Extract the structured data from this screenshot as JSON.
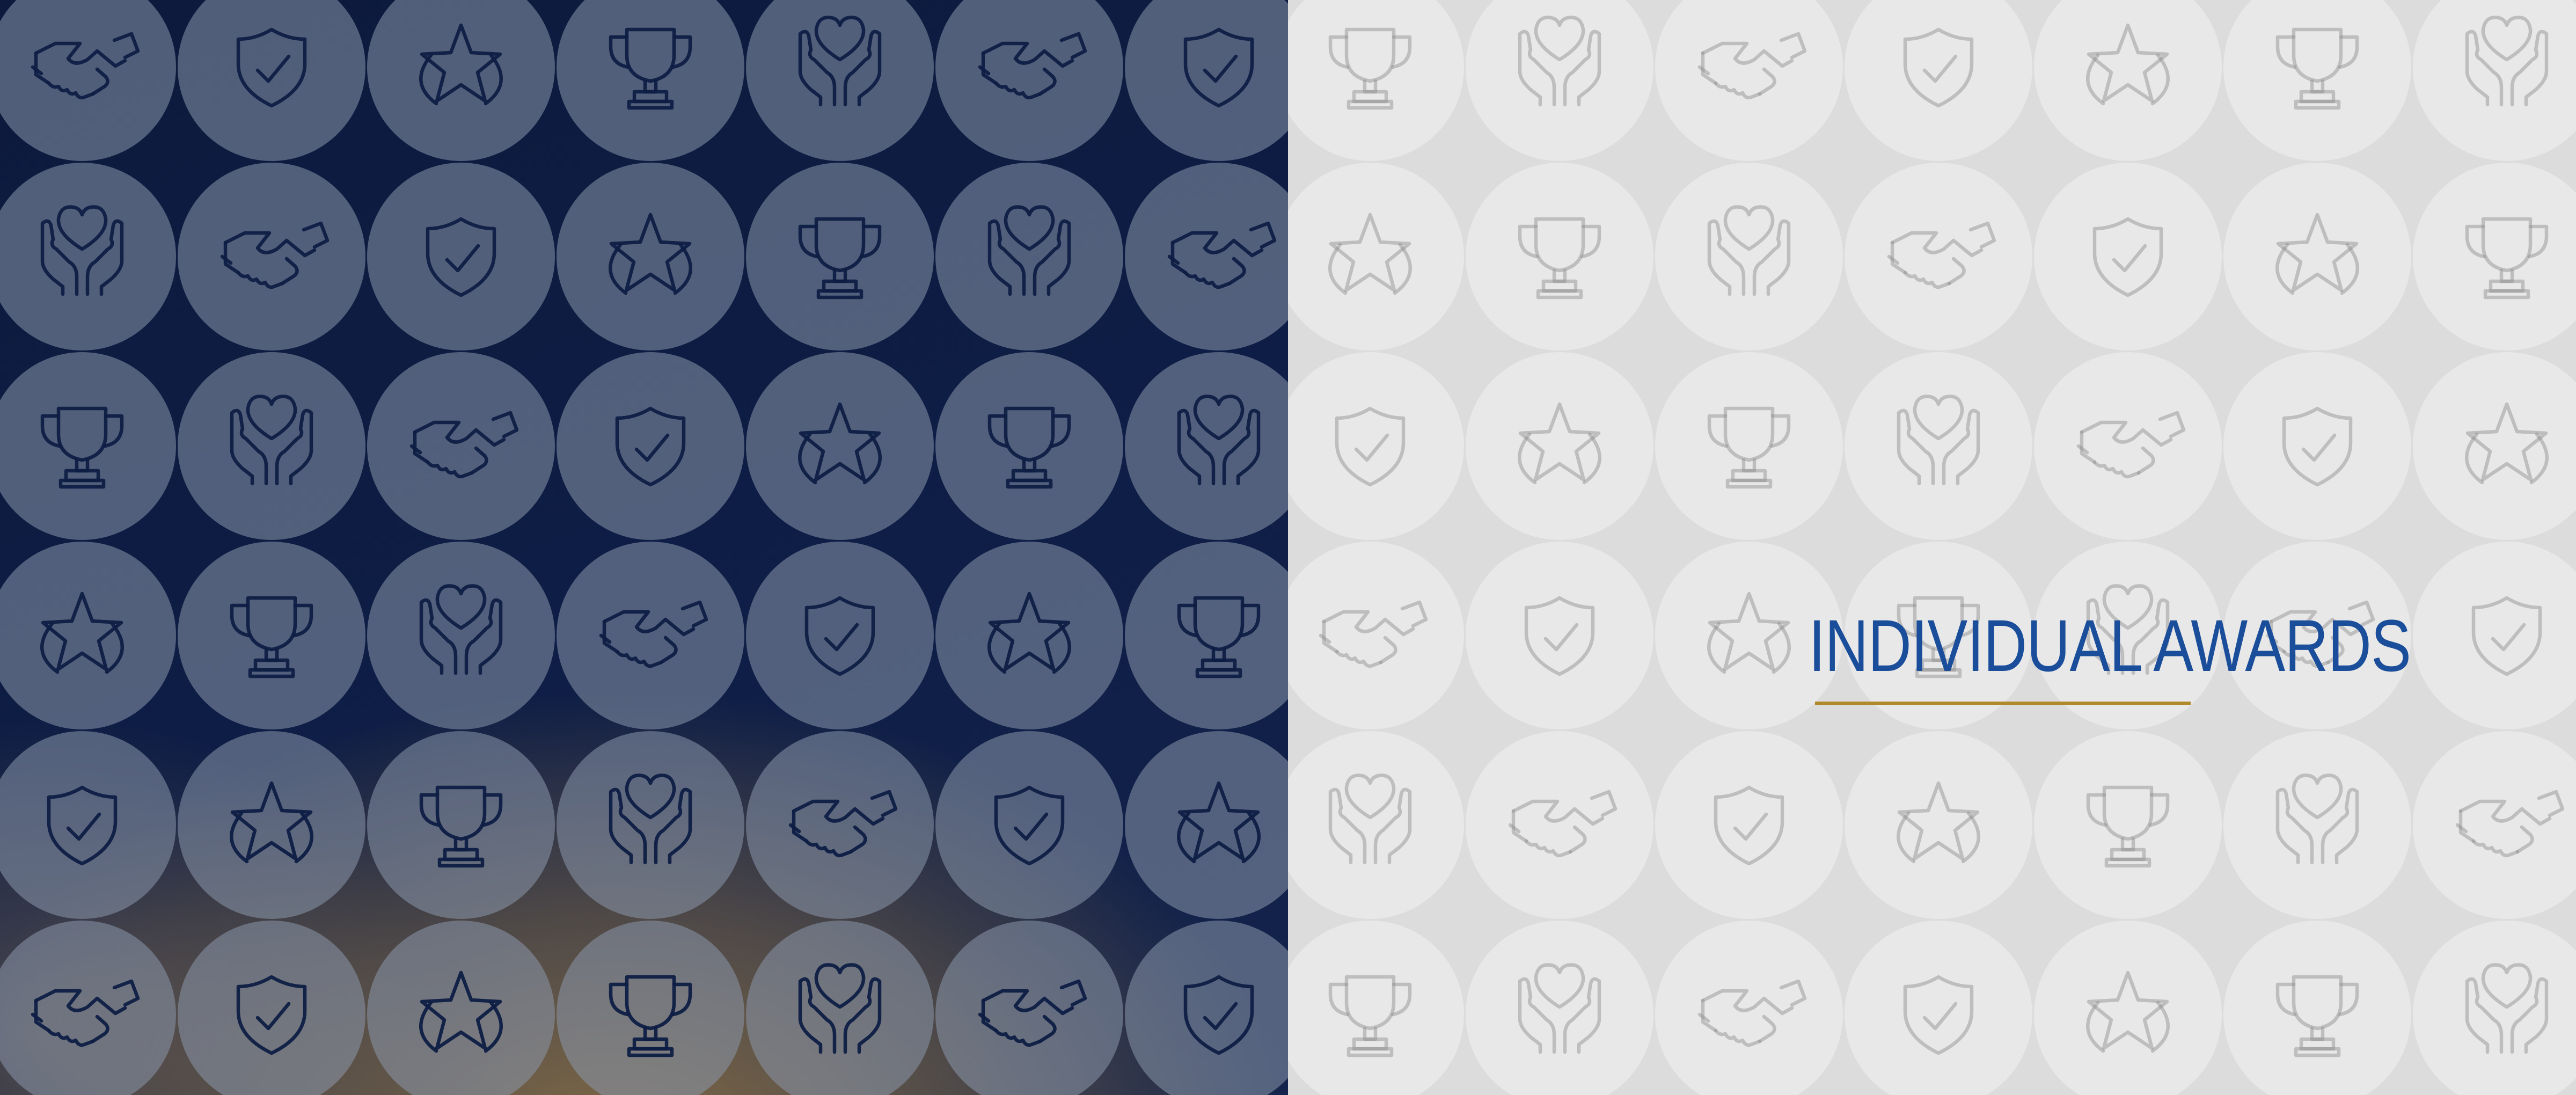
{
  "title": "INDIVIDUAL AWARDS",
  "colors": {
    "navy_background": "#0e1d45",
    "gold_glow": "#96784a",
    "light_background": "#dcdcdc",
    "circle_light": "#e8e8e8",
    "title_blue": "#1a4d9a",
    "underline_gold": "#b08a2a"
  },
  "icon_sequence": [
    "handshake-icon",
    "shield-check-icon",
    "star-icon",
    "trophy-icon",
    "heart-hands-icon"
  ]
}
